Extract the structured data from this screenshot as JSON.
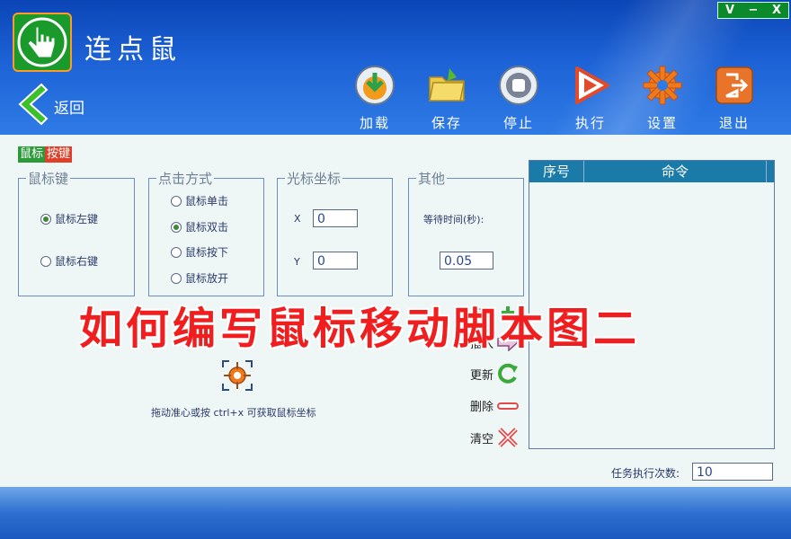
{
  "window": {
    "title": "连点鼠",
    "controls": [
      "V",
      "−",
      "X"
    ]
  },
  "nav": {
    "back_label": "返回"
  },
  "toolbar": {
    "load": "加载",
    "save": "保存",
    "stop": "停止",
    "run": "执行",
    "settings": "设置",
    "exit": "退出"
  },
  "tabs": [
    "鼠标",
    "按键"
  ],
  "mouse_key": {
    "legend": "鼠标键",
    "options": [
      "鼠标左键",
      "鼠标右键"
    ],
    "selected": 0
  },
  "click_mode": {
    "legend": "点击方式",
    "options": [
      "鼠标单击",
      "鼠标双击",
      "鼠标按下",
      "鼠标放开"
    ],
    "selected": 1
  },
  "cursor_pos": {
    "legend": "光标坐标",
    "x_label": "X",
    "x_value": "0",
    "y_label": "Y",
    "y_value": "0"
  },
  "other": {
    "legend": "其他",
    "wait_label": "等待时间(秒):",
    "wait_value": "0.05"
  },
  "list": {
    "col_index": "序号",
    "col_command": "命令"
  },
  "actions": {
    "add": "添加",
    "insert": "插入",
    "update": "更新",
    "delete": "删除",
    "clear": "清空"
  },
  "crosshair_hint": "拖动准心或按 ctrl+x 可获取鼠标坐标",
  "repeat": {
    "label": "任务执行次数:",
    "value": "10"
  },
  "overlay_text": "如何编写鼠标移动脚本图二",
  "colors": {
    "header": "#1c62d6",
    "body_bg": "#eef6f6",
    "list_header": "#1a7aa8",
    "overlay": "#f01e1e"
  }
}
